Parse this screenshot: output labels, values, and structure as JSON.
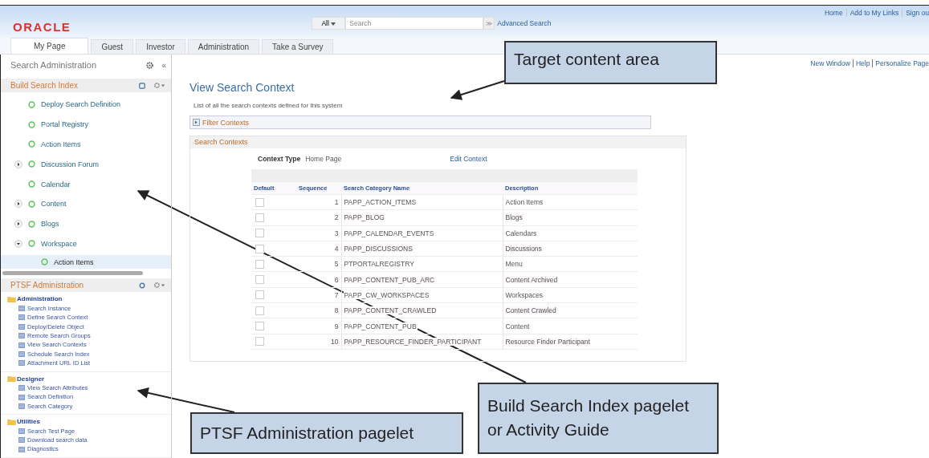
{
  "header": {
    "logo": "ORACLE",
    "search": {
      "scope": "All",
      "placeholder": "Search",
      "go": "≫",
      "advanced": "Advanced Search"
    },
    "links": [
      "Home",
      "Add to My Links",
      "Sign ou"
    ]
  },
  "tabs": [
    {
      "label": "My Page",
      "selected": true
    },
    {
      "label": "Guest",
      "selected": false
    },
    {
      "label": "Investor",
      "selected": false
    },
    {
      "label": "Administration",
      "selected": false
    },
    {
      "label": "Take a Survey",
      "selected": false
    }
  ],
  "sidebar": {
    "title": "Search Administration",
    "collapse": "«",
    "build_pagelet": {
      "title": "Build Search Index",
      "items": [
        {
          "label": "Deploy Search Definition",
          "kind": "leaf",
          "selected": false
        },
        {
          "label": "Portal Registry",
          "kind": "leaf",
          "selected": false
        },
        {
          "label": "Action Items",
          "kind": "leaf",
          "selected": false
        },
        {
          "label": "Discussion Forum",
          "kind": "collapsed",
          "selected": false
        },
        {
          "label": "Calendar",
          "kind": "leaf",
          "selected": false
        },
        {
          "label": "Content",
          "kind": "collapsed",
          "selected": false
        },
        {
          "label": "Blogs",
          "kind": "collapsed",
          "selected": false
        },
        {
          "label": "Workspace",
          "kind": "expanded",
          "selected": false,
          "children": [
            {
              "label": "Action Items",
              "selected": true
            }
          ]
        }
      ]
    },
    "ptsf_pagelet": {
      "title": "PTSF Administration",
      "groups": [
        {
          "name": "Administration",
          "links": [
            "Search Instance",
            "Define Search Context",
            "Deploy/Delete Object",
            "Remote Search Groups",
            "View Search Contexts",
            "Schedule Search Index",
            "Attachment URL ID List"
          ]
        },
        {
          "name": "Designer",
          "links": [
            "View Search Attributes",
            "Search Definition",
            "Search Category"
          ]
        },
        {
          "name": "Utilities",
          "links": [
            "Search Test Page",
            "Download search data",
            "Diagnostics"
          ]
        }
      ]
    }
  },
  "main": {
    "page_links": [
      "New Window",
      "Help",
      "Personalize Page"
    ],
    "title": "View Search Context",
    "description": "List of all the search contexts defined for this system",
    "filter": "Filter Contexts",
    "group_title": "Search Contexts",
    "context_type_label": "Context Type",
    "context_type": "Home Page",
    "edit_link": "Edit Context",
    "table": {
      "columns": [
        "Default",
        "Sequence",
        "Search Category Name",
        "Description"
      ],
      "rows": [
        {
          "checked": false,
          "sequence": "1",
          "name": "PAPP_ACTION_ITEMS",
          "description": "Action Items"
        },
        {
          "checked": false,
          "sequence": "2",
          "name": "PAPP_BLOG",
          "description": "Blogs"
        },
        {
          "checked": false,
          "sequence": "3",
          "name": "PAPP_CALENDAR_EVENTS",
          "description": "Calendars"
        },
        {
          "checked": false,
          "sequence": "4",
          "name": "PAPP_DISCUSSIONS",
          "description": "Discussions"
        },
        {
          "checked": false,
          "sequence": "5",
          "name": "PTPORTALREGISTRY",
          "description": "Menu"
        },
        {
          "checked": false,
          "sequence": "6",
          "name": "PAPP_CONTENT_PUB_ARC",
          "description": "Content Archived"
        },
        {
          "checked": false,
          "sequence": "7",
          "name": "PAPP_CW_WORKSPACES",
          "description": "Workspaces"
        },
        {
          "checked": false,
          "sequence": "8",
          "name": "PAPP_CONTENT_CRAWLED",
          "description": "Content Crawled"
        },
        {
          "checked": false,
          "sequence": "9",
          "name": "PAPP_CONTENT_PUB",
          "description": "Content"
        },
        {
          "checked": false,
          "sequence": "10",
          "name": "PAPP_RESOURCE_FINDER_PARTICIPANT",
          "description": "Resource Finder Participant"
        }
      ]
    }
  },
  "callouts": [
    {
      "text": "Target content area"
    },
    {
      "text": "PTSF Administration pagelet"
    },
    {
      "text": "Build Search Index pagelet or Activity Guide"
    }
  ]
}
